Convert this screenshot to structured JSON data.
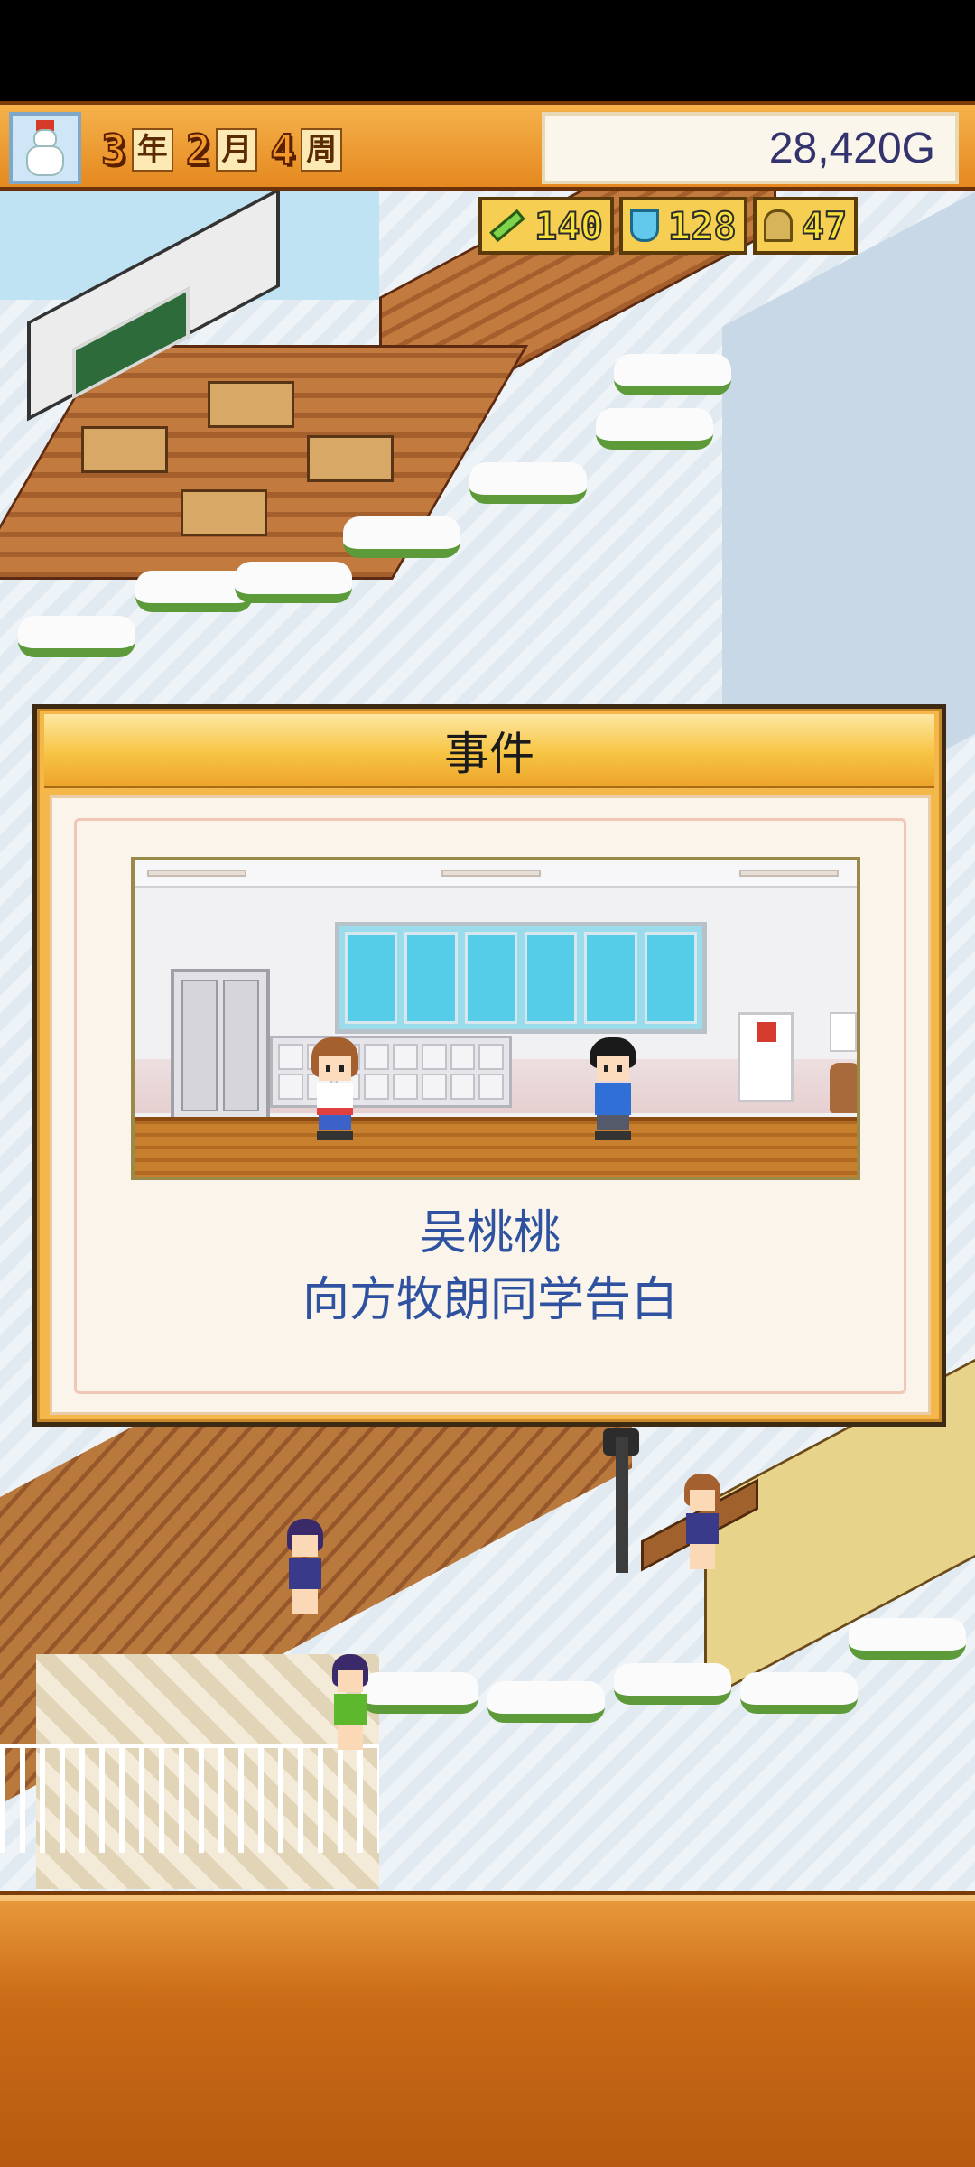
{
  "header": {
    "season_icon": "snowman-icon",
    "year_value": "3",
    "year_unit": "年",
    "month_value": "2",
    "month_unit": "月",
    "week_value": "4",
    "week_unit": "周",
    "money": "28,420G"
  },
  "resources": {
    "pencil": {
      "icon": "pencil-icon",
      "value": "140"
    },
    "flask": {
      "icon": "flask-icon",
      "value": "128"
    },
    "bell": {
      "icon": "bell-icon",
      "value": "47"
    }
  },
  "event": {
    "title": "事件",
    "line1": "吴桃桃",
    "line2": "向方牧朗同学告白"
  },
  "colors": {
    "accent_orange": "#e4891f",
    "event_text": "#2f52a0",
    "dialog_gold": "#f3b74a"
  }
}
